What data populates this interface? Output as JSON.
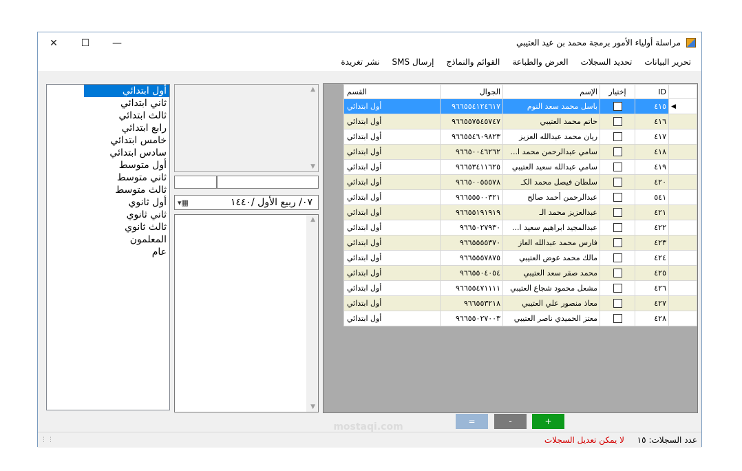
{
  "window": {
    "title": "مراسلة أولياء الأمور برمجة محمد بن عيد العتيبي",
    "minimize": "—",
    "maximize": "☐",
    "close": "✕"
  },
  "menu": [
    "تحرير البيانات",
    "تحديد السجلات",
    "العرض والطباعة",
    "القوائم والنماذج",
    "إرسال SMS",
    "نشر تغريدة"
  ],
  "stages": {
    "items": [
      "أول ابتدائي",
      "ثاني ابتدائي",
      "ثالث ابتدائي",
      "رابع ابتدائي",
      "خامس ابتدائي",
      "سادس ابتدائي",
      "أول متوسط",
      "ثاني متوسط",
      "ثالث متوسط",
      "أول ثانوي",
      "ثاني ثانوي",
      "ثالث ثانوي",
      "المعلمون",
      "عام"
    ],
    "selected": "أول ابتدائي"
  },
  "date": {
    "value": "٠٧/ ربيع الأول /١٤٤٠"
  },
  "grid": {
    "headers": {
      "id": "ID",
      "check": "إختيار",
      "name": "الإسم",
      "phone": "الجوال",
      "section": "القسم"
    },
    "rows": [
      {
        "id": "٤١٥",
        "name": "باسل محمد سعد النوم",
        "phone": "٩٦٦٥٥٤١٢٤٦١٧",
        "section": "أول ابتدائي",
        "selected": true
      },
      {
        "id": "٤١٦",
        "name": "حاتم محمد  العتيبي",
        "phone": "٩٦٦٥٥٧٥٤٥٧٤٧",
        "section": "أول ابتدائي"
      },
      {
        "id": "٤١٧",
        "name": "ريان محمد عبدالله العزيز",
        "phone": "٩٦٦٥٥٤٦٠٩٨٢٣",
        "section": "أول ابتدائي"
      },
      {
        "id": "٤١٨",
        "name": "سامي عبدالرحمن محمد ا...",
        "phone": "٩٦٦٥٠٠٤٦٢٦٢",
        "section": "أول ابتدائي"
      },
      {
        "id": "٤١٩",
        "name": "سامي عبدالله سعيد العتيبي",
        "phone": "٩٦٦٥٣٤١١٦٢٥",
        "section": "أول ابتدائي"
      },
      {
        "id": "٤٢٠",
        "name": "سلطان فيصل محمد الكـ",
        "phone": "٩٦٦٥٠٠٥٥٥٧٨",
        "section": "أول ابتدائي"
      },
      {
        "id": "٥٤١",
        "name": "عبدالرحمن أحمد صالح",
        "phone": "٩٦٦٥٥٥٠٠٣٢١",
        "section": "أول ابتدائي"
      },
      {
        "id": "٤٢١",
        "name": "عبدالعزيز محمد الـ",
        "phone": "٩٦٦٥٥١٩١٩١٩",
        "section": "أول ابتدائي"
      },
      {
        "id": "٤٢٢",
        "name": "عبدالمجيد ابراهيم سعيد ا...",
        "phone": "٩٦٦٥٠٢٧٩٣٠",
        "section": "أول ابتدائي"
      },
      {
        "id": "٤٢٣",
        "name": "فارس محمد عبدالله العاز",
        "phone": "٩٦٦٥٥٥٥٣٧٠",
        "section": "أول ابتدائي"
      },
      {
        "id": "٤٢٤",
        "name": "مالك محمد عوض العتيبي",
        "phone": "٩٦٦٥٥٥٧٨٧٥",
        "section": "أول ابتدائي"
      },
      {
        "id": "٤٢٥",
        "name": "محمد صقر سعد العتيبي",
        "phone": "٩٦٦٥٥٠٤٠٥٤",
        "section": "أول ابتدائي"
      },
      {
        "id": "٤٢٦",
        "name": "مشعل محمود شجاع العتيبي",
        "phone": "٩٦٦٥٥٤٧١١١١",
        "section": "أول ابتدائي"
      },
      {
        "id": "٤٢٧",
        "name": "معاذ منصور علي العتيبي",
        "phone": "٩٦٦٥٥٣٢١٨",
        "section": "أول ابتدائي"
      },
      {
        "id": "٤٢٨",
        "name": "معتز الحميدي ناصر العتيبي",
        "phone": "٩٦٦٥٥٠٢٧٠٠٣",
        "section": "أول ابتدائي"
      }
    ]
  },
  "buttons": {
    "add": "+",
    "remove": "-",
    "edit": "="
  },
  "colors": {
    "add": "#0c9a1b",
    "remove": "#7a7a7a",
    "edit": "#9bb7d6",
    "selection": "#3399ff",
    "alt_row": "#f0efd6"
  },
  "status": {
    "count_label": "عدد السجلات: ١٥",
    "message": "لا يمكن تعديل السجلات"
  },
  "watermark": "mostaqi.com"
}
